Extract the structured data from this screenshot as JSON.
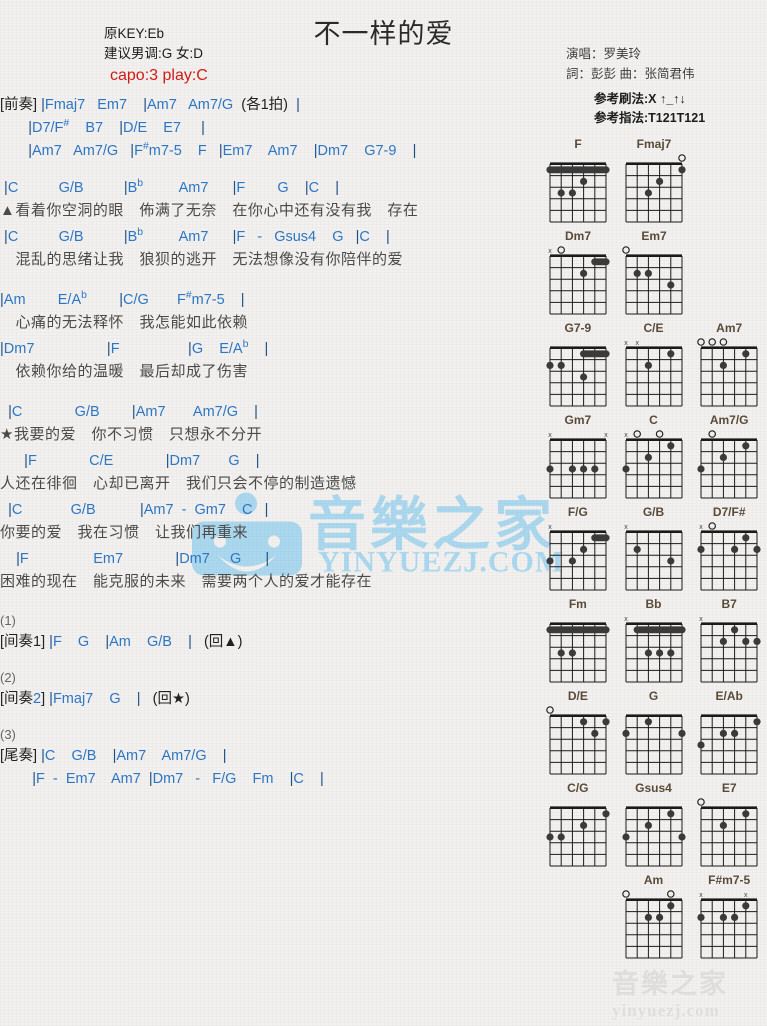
{
  "header": {
    "orig_key": "原KEY:Eb",
    "suggest_key": "建议男调:G 女:D",
    "capo": "capo:3 play:C",
    "title": "不一样的爱",
    "singer": "演唱：罗美玲",
    "credits": "詞：彭彭   曲：张简君伟",
    "strum_ref": "参考刷法:X ↑_↑↓",
    "fingerstyle_ref": "参考指法:T121T121"
  },
  "colors": {
    "chord": "#2c76c4",
    "capo_red": "#d21a14",
    "lyric": "#4a4a4a",
    "diagram_name": "#5a4a3a"
  },
  "sections": [
    {
      "name": "intro",
      "lines": [
        {
          "type": "chords",
          "text": "[前奏] |Fmaj7   Em7    |Am7   Am7/G  (各1拍)  |"
        },
        {
          "type": "chords",
          "text": "       |D7/F#    B7    |D/E    E7     |"
        },
        {
          "type": "chords",
          "text": "       |Am7   Am7/G   |F#m7-5    F   |Em7    Am7    |Dm7    G7-9    |"
        }
      ]
    },
    {
      "name": "verse-1",
      "lines": [
        {
          "type": "chords",
          "text": " |C          G/B          |Bb         Am7      |F        G    |C    |"
        },
        {
          "type": "lyrics",
          "text": "▲看着你空洞的眼　佈满了无奈　在你心中还有没有我　存在"
        },
        {
          "type": "chords",
          "text": " |C          G/B          |Bb         Am7      |F   -   Gsus4    G   |C    |"
        },
        {
          "type": "lyrics",
          "text": "　混乱的思绪让我　狼狈的逃开　无法想像没有你陪伴的爱"
        }
      ]
    },
    {
      "name": "verse-2",
      "lines": [
        {
          "type": "chords",
          "text": "|Am        E/Ab        |C/G       F#m7-5    |"
        },
        {
          "type": "lyrics",
          "text": "　心痛的无法释怀　我怎能如此依赖"
        },
        {
          "type": "chords",
          "text": "|Dm7                  |F                 |G    E/Ab    |"
        },
        {
          "type": "lyrics",
          "text": "　依赖你给的温暖　最后却成了伤害"
        }
      ]
    },
    {
      "name": "chorus",
      "lines": [
        {
          "type": "chords",
          "text": "  |C             G/B        |Am7       Am7/G    |"
        },
        {
          "type": "lyrics",
          "text": "★我要的爱　你不习惯　只想永不分开"
        },
        {
          "type": "chords",
          "text": "      |F             C/E             |Dm7       G    |"
        },
        {
          "type": "lyrics",
          "text": "人还在徘徊　心却已离开　我们只会不停的制造遗憾"
        },
        {
          "type": "chords",
          "text": "  |C            G/B           |Am7  -  Gm7    C   |"
        },
        {
          "type": "lyrics",
          "text": "你要的爱　我在习惯　让我们再重来"
        },
        {
          "type": "chords",
          "text": "    |F                Em7             |Dm7     G      |"
        },
        {
          "type": "lyrics",
          "text": "困难的现在　能克服的未来　需要两个人的爱才能存在"
        }
      ]
    },
    {
      "name": "interlude-1",
      "lines": [
        {
          "type": "num",
          "text": "(1)"
        },
        {
          "type": "chords",
          "text": "[间奏1] |F    G    |Am    G/B    |   (回▲)"
        }
      ]
    },
    {
      "name": "interlude-2",
      "lines": [
        {
          "type": "num",
          "text": "(2)"
        },
        {
          "type": "chords",
          "text": "[间奏2] |Fmaj7    G    |   (回★)"
        }
      ]
    },
    {
      "name": "outro",
      "lines": [
        {
          "type": "num",
          "text": "(3)"
        },
        {
          "type": "chords",
          "text": "[尾奏] |C    G/B    |Am7    Am7/G    |"
        },
        {
          "type": "chords",
          "text": "        |F  -  Em7    Am7  |Dm7   -   F/G    Fm    |C    |"
        }
      ]
    }
  ],
  "diagrams": {
    "rows": [
      {
        "cols": 2,
        "items": [
          {
            "name": "F",
            "open": [
              "",
              "",
              "",
              "",
              "",
              ""
            ],
            "barre": {
              "fret": 1,
              "from": 0,
              "to": 5
            },
            "dots": [
              [
                2,
                3
              ],
              [
                3,
                2
              ],
              [
                3,
                1
              ]
            ]
          },
          {
            "name": "Fmaj7",
            "open": [
              "",
              "",
              "",
              "",
              "",
              "o"
            ],
            "dots": [
              [
                1,
                5
              ],
              [
                2,
                3
              ],
              [
                3,
                2
              ]
            ]
          }
        ]
      },
      {
        "cols": 2,
        "items": [
          {
            "name": "Dm7",
            "open": [
              "x",
              "o",
              "",
              "",
              "",
              ""
            ],
            "barre": {
              "fret": 1,
              "from": 4,
              "to": 5
            },
            "dots": [
              [
                2,
                3
              ]
            ]
          },
          {
            "name": "Em7",
            "open": [
              "o",
              "",
              "",
              "",
              "",
              ""
            ],
            "dots": [
              [
                2,
                1
              ],
              [
                2,
                2
              ],
              [
                3,
                4
              ]
            ]
          }
        ]
      },
      {
        "cols": 3,
        "items": [
          {
            "name": "G7-9",
            "open": [
              "",
              "",
              "",
              "",
              "",
              ""
            ],
            "barre": {
              "fret": 1,
              "from": 3,
              "to": 5
            },
            "dots": [
              [
                2,
                1
              ],
              [
                2,
                0
              ],
              [
                3,
                3
              ]
            ]
          },
          {
            "name": "C/E",
            "open": [
              "x",
              "x",
              "",
              "",
              "",
              ""
            ],
            "dots": [
              [
                1,
                4
              ],
              [
                2,
                2
              ]
            ]
          },
          {
            "name": "Am7",
            "open": [
              "o",
              "o",
              "o",
              "",
              "",
              ""
            ],
            "dots": [
              [
                2,
                2
              ],
              [
                1,
                4
              ]
            ]
          }
        ]
      },
      {
        "cols": 3,
        "items": [
          {
            "name": "Gm7",
            "open": [
              "x",
              "",
              "",
              "",
              "",
              "x"
            ],
            "dots": [
              [
                3,
                0
              ],
              [
                3,
                2
              ],
              [
                3,
                3
              ],
              [
                3,
                4
              ]
            ]
          },
          {
            "name": "C",
            "open": [
              "x",
              "o",
              "",
              "o",
              "",
              ""
            ],
            "dots": [
              [
                1,
                4
              ],
              [
                2,
                2
              ],
              [
                3,
                0
              ]
            ]
          },
          {
            "name": "Am7/G",
            "open": [
              "",
              "o",
              "",
              "",
              "",
              ""
            ],
            "dots": [
              [
                1,
                4
              ],
              [
                2,
                2
              ],
              [
                3,
                0
              ]
            ]
          }
        ]
      },
      {
        "cols": 3,
        "items": [
          {
            "name": "F/G",
            "open": [
              "x",
              "",
              "",
              "",
              "",
              ""
            ],
            "barre": {
              "fret": 1,
              "from": 4,
              "to": 5
            },
            "dots": [
              [
                2,
                3
              ],
              [
                3,
                0
              ],
              [
                3,
                2
              ]
            ]
          },
          {
            "name": "G/B",
            "open": [
              "x",
              "",
              "",
              "",
              "",
              ""
            ],
            "dots": [
              [
                2,
                1
              ],
              [
                3,
                4
              ]
            ]
          },
          {
            "name": "D7/F#",
            "open": [
              "x",
              "o",
              "",
              "",
              "",
              ""
            ],
            "dots": [
              [
                1,
                4
              ],
              [
                2,
                0
              ],
              [
                2,
                3
              ],
              [
                2,
                5
              ]
            ]
          }
        ]
      },
      {
        "cols": 3,
        "items": [
          {
            "name": "Fm",
            "open": [
              "",
              "",
              "",
              "",
              "",
              ""
            ],
            "barre": {
              "fret": 1,
              "from": 0,
              "to": 5
            },
            "dots": [
              [
                3,
                1
              ],
              [
                3,
                2
              ]
            ]
          },
          {
            "name": "Bb",
            "open": [
              "x",
              "",
              "",
              "",
              "",
              ""
            ],
            "barre": {
              "fret": 1,
              "from": 1,
              "to": 5
            },
            "dots": [
              [
                3,
                2
              ],
              [
                3,
                3
              ],
              [
                3,
                4
              ]
            ]
          },
          {
            "name": "B7",
            "open": [
              "x",
              "",
              "",
              "",
              "",
              ""
            ],
            "dots": [
              [
                1,
                3
              ],
              [
                2,
                2
              ],
              [
                2,
                4
              ],
              [
                2,
                5
              ]
            ]
          }
        ]
      },
      {
        "cols": 3,
        "items": [
          {
            "name": "D/E",
            "open": [
              "o",
              "",
              "",
              "",
              "",
              ""
            ],
            "dots": [
              [
                1,
                3
              ],
              [
                1,
                5
              ],
              [
                2,
                4
              ]
            ]
          },
          {
            "name": "G",
            "open": [
              "",
              "",
              "",
              "",
              "",
              ""
            ],
            "dots": [
              [
                1,
                2
              ],
              [
                2,
                0
              ],
              [
                2,
                5
              ]
            ]
          },
          {
            "name": "E/Ab",
            "open": [
              "",
              "",
              "",
              "",
              "",
              ""
            ],
            "dots": [
              [
                1,
                5
              ],
              [
                2,
                2
              ],
              [
                2,
                3
              ],
              [
                3,
                0
              ]
            ]
          }
        ]
      },
      {
        "cols": 3,
        "items": [
          {
            "name": "C/G",
            "open": [
              "",
              "",
              "",
              "",
              "",
              ""
            ],
            "dots": [
              [
                1,
                5
              ],
              [
                2,
                3
              ],
              [
                3,
                0
              ],
              [
                3,
                1
              ]
            ]
          },
          {
            "name": "Gsus4",
            "open": [
              "",
              "",
              "",
              "",
              "",
              ""
            ],
            "dots": [
              [
                1,
                4
              ],
              [
                2,
                2
              ],
              [
                3,
                0
              ],
              [
                3,
                5
              ]
            ]
          },
          {
            "name": "E7",
            "open": [
              "o",
              "",
              "",
              "",
              "",
              ""
            ],
            "dots": [
              [
                1,
                4
              ],
              [
                2,
                2
              ]
            ]
          }
        ]
      },
      {
        "cols": 3,
        "offset": 1,
        "items": [
          {
            "name": "Am",
            "open": [
              "o",
              "",
              "",
              "",
              "o",
              ""
            ],
            "dots": [
              [
                1,
                4
              ],
              [
                2,
                2
              ],
              [
                2,
                3
              ]
            ]
          },
          {
            "name": "F#m7-5",
            "open": [
              "x",
              "",
              "",
              "",
              "x",
              ""
            ],
            "dots": [
              [
                1,
                4
              ],
              [
                2,
                0
              ],
              [
                2,
                2
              ],
              [
                2,
                3
              ]
            ]
          }
        ]
      }
    ]
  },
  "watermarks": {
    "center_cn": "音樂之家",
    "center_en": "YINYUEZJ.COM",
    "bottom_cn": "音樂之家",
    "bottom_en": "yinyuezj.com"
  }
}
